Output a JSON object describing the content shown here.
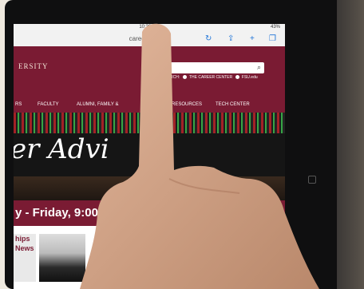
{
  "status_bar": {
    "time": "10:38 AM",
    "battery": "43%"
  },
  "browser": {
    "url": "career.fsu.edu"
  },
  "header": {
    "university": "ERSITY",
    "search_scope_label": "RCH:",
    "search_options": [
      "THE CAREER CENTER",
      "FSU.edu"
    ]
  },
  "nav": {
    "items": [
      "RS",
      "FACULTY",
      "ALUMNI, FAMILY &",
      "RESOURCES",
      "TECH CENTER"
    ]
  },
  "hero": {
    "title": "er Advi"
  },
  "hours": {
    "text": "y - Friday, 9:00 -"
  },
  "promo": {
    "lines": [
      "hips",
      "News"
    ]
  },
  "colors": {
    "fsu_garnet": "#7a1b33"
  }
}
